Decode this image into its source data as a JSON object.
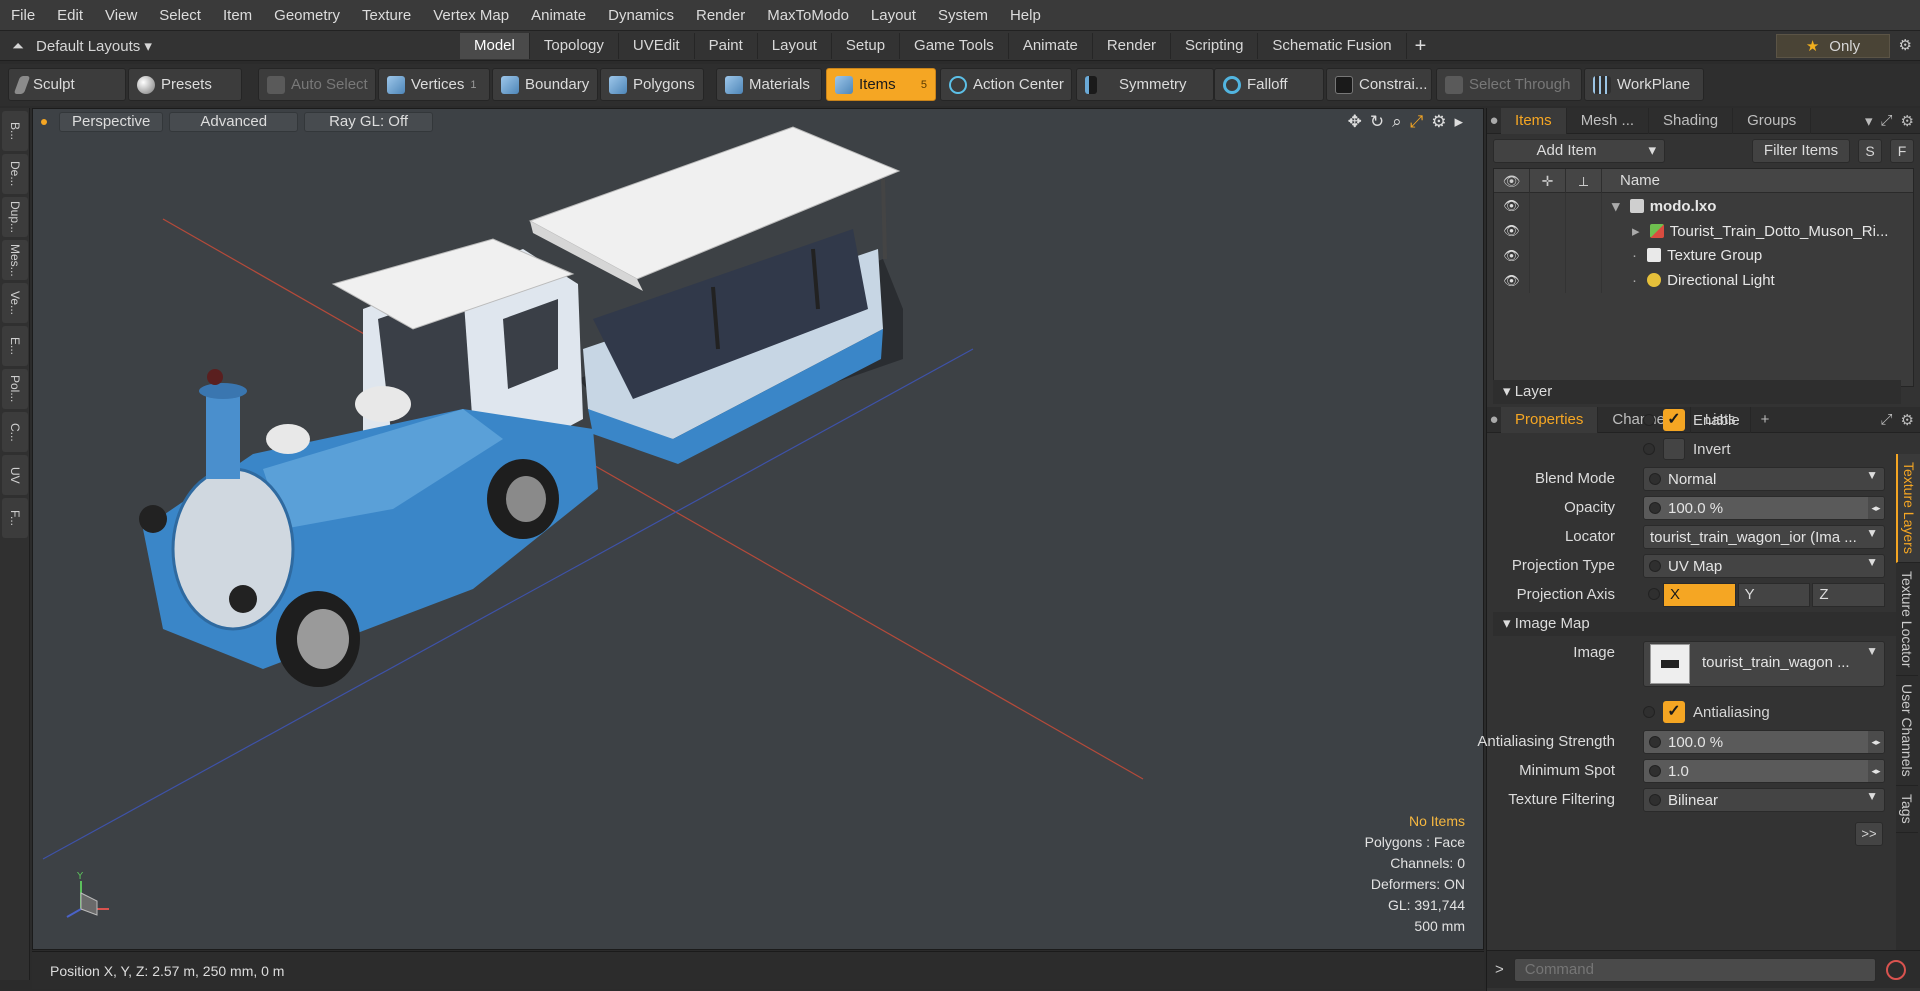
{
  "menu": [
    "File",
    "Edit",
    "View",
    "Select",
    "Item",
    "Geometry",
    "Texture",
    "Vertex Map",
    "Animate",
    "Dynamics",
    "Render",
    "MaxToModo",
    "Layout",
    "System",
    "Help"
  ],
  "layouts": {
    "label": "Default Layouts ▾"
  },
  "layout_tabs": [
    "Model",
    "Topology",
    "UVEdit",
    "Paint",
    "Layout",
    "Setup",
    "Game Tools",
    "Animate",
    "Render",
    "Scripting",
    "Schematic Fusion"
  ],
  "layout_tab_active": "Model",
  "only_label": "Only",
  "toolbar": {
    "sculpt": "Sculpt",
    "presets": "Presets",
    "auto_select": "Auto Select",
    "vertices": "Vertices",
    "vertices_count": "1",
    "boundary": "Boundary",
    "polygons": "Polygons",
    "materials": "Materials",
    "items": "Items",
    "items_count": "5",
    "action_center": "Action Center",
    "symmetry": "Symmetry",
    "falloff": "Falloff",
    "constraints": "Constrai...",
    "select_through": "Select Through",
    "workplane": "WorkPlane"
  },
  "left_strip": [
    "B...",
    "De...",
    "Dup...",
    "Mes...",
    "Ve...",
    "E...",
    "Pol...",
    "C...",
    "UV",
    "F..."
  ],
  "viewport": {
    "view_mode": "Perspective",
    "shading": "Advanced",
    "raygl": "Ray GL: Off",
    "info": {
      "selection": "No Items",
      "polygons": "Polygons : Face",
      "channels": "Channels: 0",
      "deformers": "Deformers: ON",
      "gl": "GL: 391,744",
      "scale": "500 mm"
    }
  },
  "position": "Position X, Y, Z:   2.57 m, 250 mm, 0 m",
  "items_panel": {
    "tabs": [
      "Items",
      "Mesh ...",
      "Shading",
      "Groups"
    ],
    "active_tab": "Items",
    "add_item": "Add Item",
    "filter_items": "Filter Items",
    "s_btn": "S",
    "f_btn": "F",
    "name_header": "Name",
    "rows": [
      {
        "name": "modo.lxo",
        "icon": "scene-icon"
      },
      {
        "name": "Tourist_Train_Dotto_Muson_Ri...",
        "icon": "locator-icon"
      },
      {
        "name": "Texture Group",
        "icon": "texture-group-icon"
      },
      {
        "name": "Directional Light",
        "icon": "light-icon"
      }
    ]
  },
  "properties_panel": {
    "tabs": [
      "Properties",
      "Channels",
      "Lists"
    ],
    "active_tab": "Properties",
    "layer_section": "Layer",
    "enable": "Enable",
    "invert": "Invert",
    "blend_mode_label": "Blend Mode",
    "blend_mode": "Normal",
    "opacity_label": "Opacity",
    "opacity": "100.0 %",
    "locator_label": "Locator",
    "locator": "tourist_train_wagon_ior (Ima ...",
    "projection_type_label": "Projection Type",
    "projection_type": "UV Map",
    "projection_axis_label": "Projection Axis",
    "axes": [
      "X",
      "Y",
      "Z"
    ],
    "axis_active": "X",
    "image_map_section": "Image Map",
    "image_label": "Image",
    "image": "tourist_train_wagon ...",
    "antialiasing": "Antialiasing",
    "aa_strength_label": "Antialiasing Strength",
    "aa_strength": "100.0 %",
    "min_spot_label": "Minimum Spot",
    "min_spot": "1.0",
    "tex_filter_label": "Texture Filtering",
    "tex_filter": "Bilinear",
    "more": ">>"
  },
  "vertical_tabs": [
    "Texture Layers",
    "Texture Locator",
    "User Channels",
    "Tags"
  ],
  "command": {
    "prompt": ">",
    "placeholder": "Command"
  },
  "colors": {
    "accent": "#f5a623",
    "viewport_bg": "#3d4145",
    "train_blue": "#3a86c8"
  }
}
